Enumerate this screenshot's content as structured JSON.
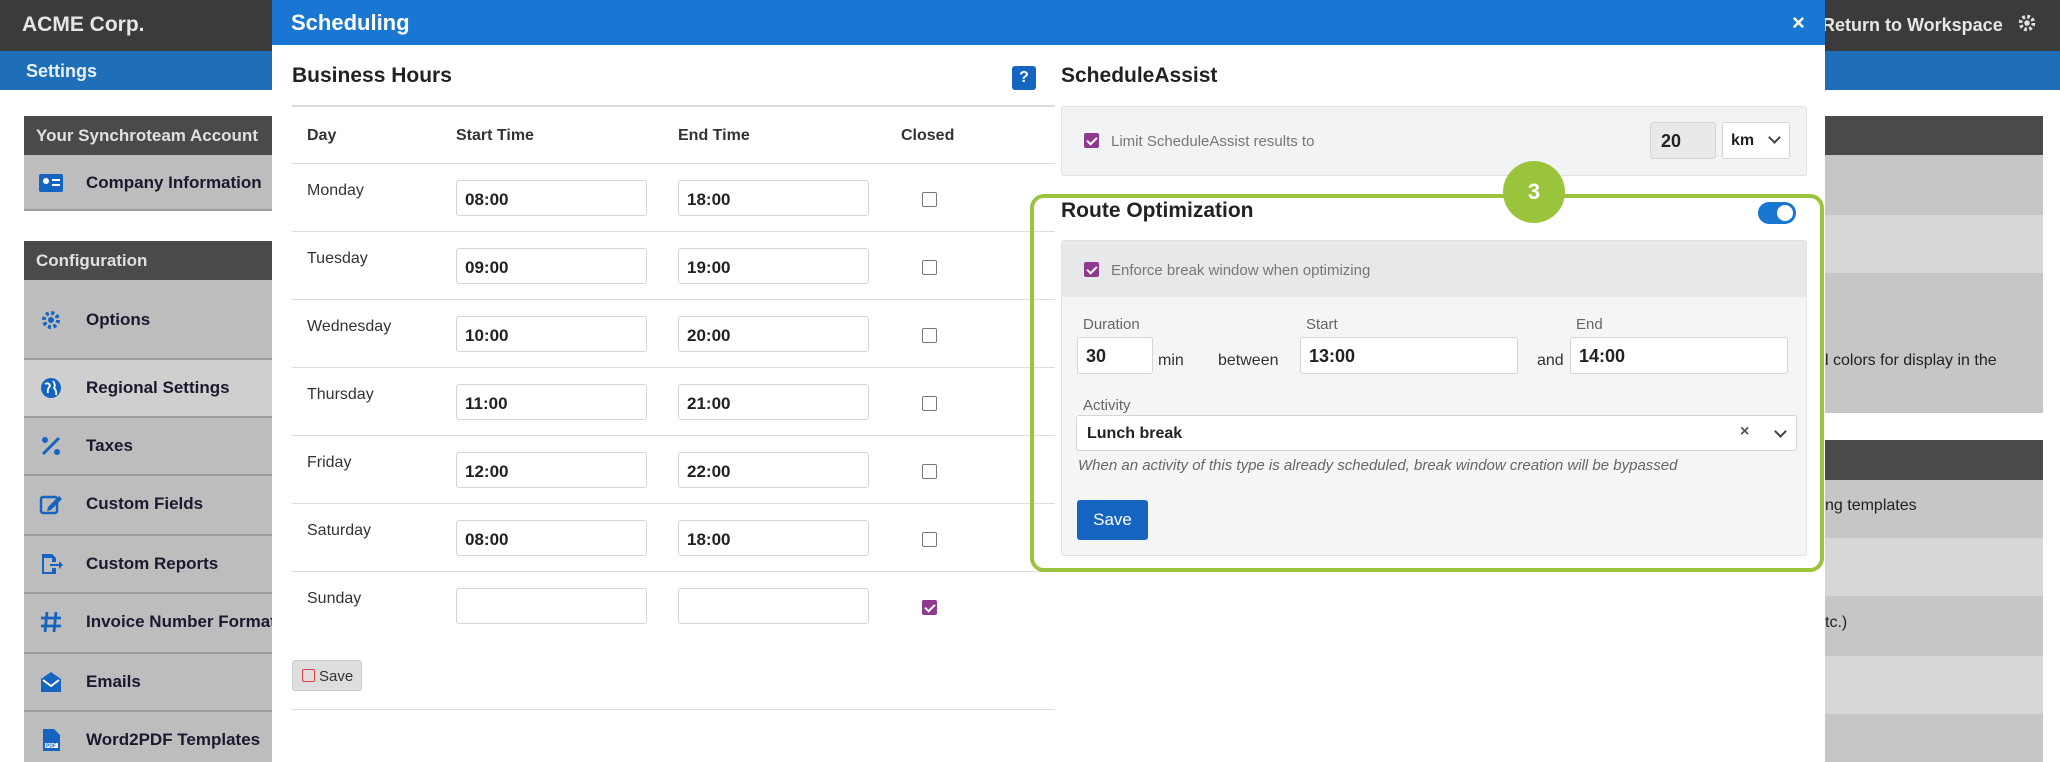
{
  "app": {
    "title": "ACME Corp.",
    "return_label": "Return to Workspace",
    "settings_label": "Settings"
  },
  "sidebar": {
    "account_header": "Your Synchroteam Account",
    "account_item": "Company Information",
    "config_header": "Configuration",
    "items": [
      {
        "label": "Options",
        "icon": "gear-icon"
      },
      {
        "label": "Regional Settings",
        "icon": "globe-icon"
      },
      {
        "label": "Taxes",
        "icon": "percent-icon"
      },
      {
        "label": "Custom Fields",
        "icon": "edit-icon"
      },
      {
        "label": "Custom Reports",
        "icon": "export-icon"
      },
      {
        "label": "Invoice Number Format",
        "icon": "hash-icon"
      },
      {
        "label": "Emails",
        "icon": "envelope-icon"
      },
      {
        "label": "Word2PDF Templates",
        "icon": "pdf-icon"
      }
    ]
  },
  "right_panel": {
    "text1": "l colors for display in the",
    "text2": "ng templates",
    "text3": "tc.)"
  },
  "modal": {
    "title": "Scheduling",
    "close": "×",
    "business_hours": {
      "title": "Business Hours",
      "help": "?",
      "columns": [
        "Day",
        "Start Time",
        "End Time",
        "Closed"
      ],
      "rows": [
        {
          "day": "Monday",
          "start": "08:00",
          "end": "18:00",
          "closed": false
        },
        {
          "day": "Tuesday",
          "start": "09:00",
          "end": "19:00",
          "closed": false
        },
        {
          "day": "Wednesday",
          "start": "10:00",
          "end": "20:00",
          "closed": false
        },
        {
          "day": "Thursday",
          "start": "11:00",
          "end": "21:00",
          "closed": false
        },
        {
          "day": "Friday",
          "start": "12:00",
          "end": "22:00",
          "closed": false
        },
        {
          "day": "Saturday",
          "start": "08:00",
          "end": "18:00",
          "closed": false
        },
        {
          "day": "Sunday",
          "start": "",
          "end": "",
          "closed": true
        }
      ],
      "save": "Save"
    },
    "schedule_assist": {
      "title": "ScheduleAssist",
      "limit_label": "Limit ScheduleAssist results to",
      "limit_value": "20",
      "unit": "km"
    },
    "route_optimization": {
      "title": "Route Optimization",
      "badge": "3",
      "enabled": true,
      "enforce_label": "Enforce break window when optimizing",
      "duration_label": "Duration",
      "duration_value": "30",
      "min_label": "min",
      "between_label": "between",
      "start_label": "Start",
      "start_value": "13:00",
      "and_label": "and",
      "end_label": "End",
      "end_value": "14:00",
      "activity_label": "Activity",
      "activity_value": "Lunch break",
      "activity_clear": "×",
      "help_text": "When an activity of this type is already scheduled, break window creation will be bypassed",
      "save": "Save"
    }
  },
  "colors": {
    "primary": "#1976d2",
    "highlight": "#9ac43c",
    "check": "#8e3a8e",
    "topbar": "#3b3b3b"
  }
}
